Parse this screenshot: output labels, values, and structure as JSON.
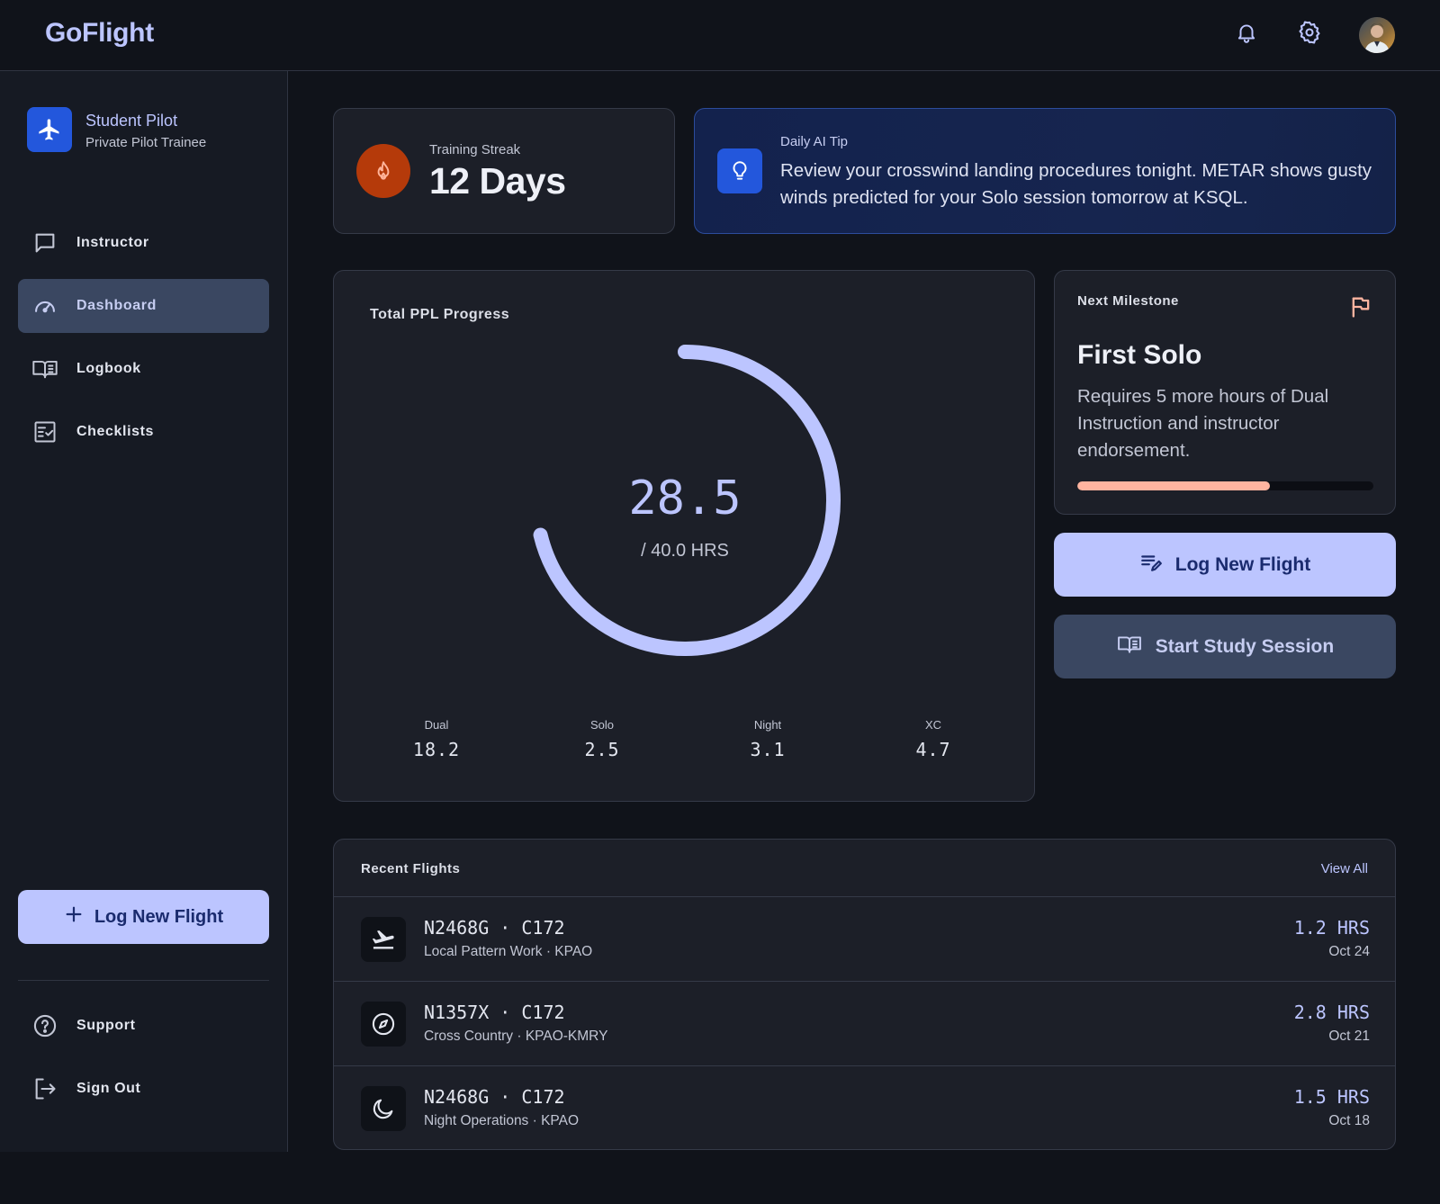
{
  "app": {
    "title": "GoFlight"
  },
  "profile": {
    "name": "Student Pilot",
    "role": "Private Pilot Trainee"
  },
  "nav": {
    "items": [
      {
        "label": "Instructor",
        "icon": "chat-icon"
      },
      {
        "label": "Dashboard",
        "icon": "gauge-icon",
        "active": true
      },
      {
        "label": "Logbook",
        "icon": "book-icon"
      },
      {
        "label": "Checklists",
        "icon": "checklist-icon"
      }
    ],
    "log_button": "Log New Flight",
    "support": "Support",
    "sign_out": "Sign Out"
  },
  "streak": {
    "label": "Training Streak",
    "value": "12 Days"
  },
  "tip": {
    "label": "Daily AI Tip",
    "text": "Review your crosswind landing procedures tonight. METAR shows gusty winds predicted for your Solo session tomorrow at KSQL."
  },
  "progress": {
    "title": "Total PPL Progress",
    "hours": 28.5,
    "hours_text": "28.5",
    "target_text": "/ 40.0 HRS",
    "target": 40.0,
    "stats": [
      {
        "label": "Dual",
        "value": "18.2"
      },
      {
        "label": "Solo",
        "value": "2.5"
      },
      {
        "label": "Night",
        "value": "3.1"
      },
      {
        "label": "XC",
        "value": "4.7"
      }
    ]
  },
  "milestone": {
    "label": "Next Milestone",
    "title": "First Solo",
    "description": "Requires 5 more hours of Dual Instruction and instructor endorsement.",
    "progress_fraction": 0.65
  },
  "actions": {
    "log_flight": "Log New Flight",
    "study": "Start Study Session"
  },
  "recent": {
    "title": "Recent Flights",
    "view_all": "View All",
    "flights": [
      {
        "tail": "N2468G · C172",
        "desc": "Local Pattern Work · KPAO",
        "hrs": "1.2 HRS",
        "date": "Oct 24",
        "icon": "takeoff-icon"
      },
      {
        "tail": "N1357X · C172",
        "desc": "Cross Country · KPAO-KMRY",
        "hrs": "2.8 HRS",
        "date": "Oct 21",
        "icon": "compass-icon"
      },
      {
        "tail": "N2468G · C172",
        "desc": "Night Operations · KPAO",
        "hrs": "1.5 HRS",
        "date": "Oct 18",
        "icon": "moon-icon"
      }
    ]
  },
  "colors": {
    "accent": "#bcc5ff",
    "streak": "#b53a0a",
    "tip_bg": "#13224d",
    "milestone_fill": "#ffb4a0"
  }
}
